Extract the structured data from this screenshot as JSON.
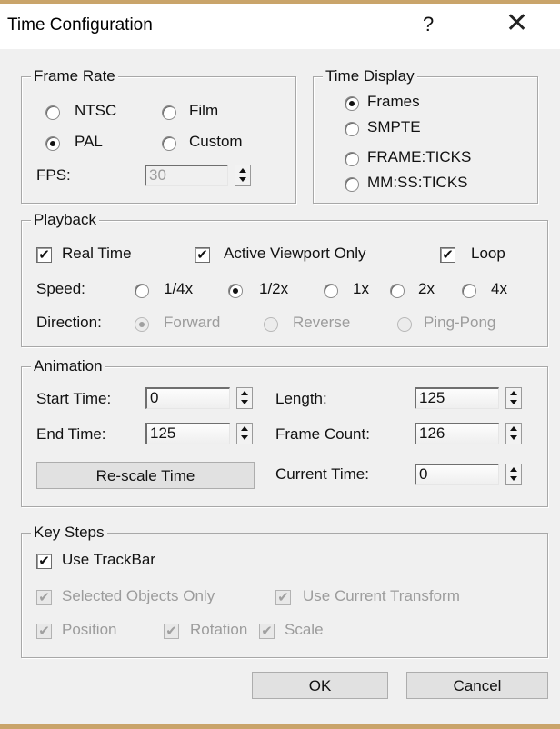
{
  "window": {
    "title": "Time Configuration",
    "help_glyph": "?",
    "close_glyph": "✕"
  },
  "frame_rate": {
    "legend": "Frame Rate",
    "options": [
      "NTSC",
      "Film",
      "PAL",
      "Custom"
    ],
    "selected": "PAL",
    "fps_label": "FPS:",
    "fps_value": "30"
  },
  "time_display": {
    "legend": "Time Display",
    "options": [
      "Frames",
      "SMPTE",
      "FRAME:TICKS",
      "MM:SS:TICKS"
    ],
    "selected": "Frames"
  },
  "playback": {
    "legend": "Playback",
    "real_time": {
      "label": "Real Time",
      "checked": true
    },
    "active_viewport": {
      "label": "Active Viewport Only",
      "checked": true
    },
    "loop": {
      "label": "Loop",
      "checked": true
    },
    "speed_label": "Speed:",
    "speeds": [
      "1/4x",
      "1/2x",
      "1x",
      "2x",
      "4x"
    ],
    "speed_selected": "1/2x",
    "direction_label": "Direction:",
    "directions": [
      "Forward",
      "Reverse",
      "Ping-Pong"
    ],
    "direction_selected": "Forward"
  },
  "animation": {
    "legend": "Animation",
    "start_time_label": "Start Time:",
    "start_time": "0",
    "end_time_label": "End Time:",
    "end_time": "125",
    "length_label": "Length:",
    "length": "125",
    "frame_count_label": "Frame Count:",
    "frame_count": "126",
    "rescale_label": "Re-scale Time",
    "current_time_label": "Current Time:",
    "current_time": "0"
  },
  "key_steps": {
    "legend": "Key Steps",
    "use_trackbar": {
      "label": "Use TrackBar",
      "checked": true
    },
    "selected_only": {
      "label": "Selected Objects Only",
      "checked": true
    },
    "use_current_transform": {
      "label": "Use Current Transform",
      "checked": true
    },
    "position": {
      "label": "Position",
      "checked": true
    },
    "rotation": {
      "label": "Rotation",
      "checked": true
    },
    "scale": {
      "label": "Scale",
      "checked": true
    }
  },
  "buttons": {
    "ok": "OK",
    "cancel": "Cancel"
  },
  "check_glyph": "✔"
}
